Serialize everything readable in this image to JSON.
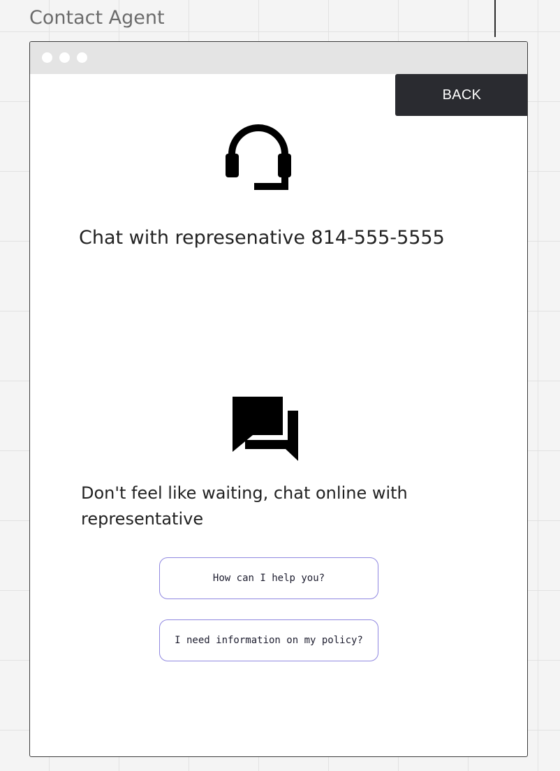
{
  "frame": {
    "title": "Contact Agent"
  },
  "window": {
    "back_label": "BACK"
  },
  "phone": {
    "icon": "headset-icon",
    "text": "Chat with represenative 814-555-5555"
  },
  "online": {
    "icon": "chat-bubbles-icon",
    "text": "Don't feel like waiting, chat online with representative"
  },
  "chat_options": [
    {
      "label": "How can I help you?"
    },
    {
      "label": "I need information on my policy?"
    }
  ],
  "colors": {
    "back_button_bg": "#2a2b30",
    "option_border": "#8f87e0",
    "titlebar_bg": "#e4e4e4"
  }
}
